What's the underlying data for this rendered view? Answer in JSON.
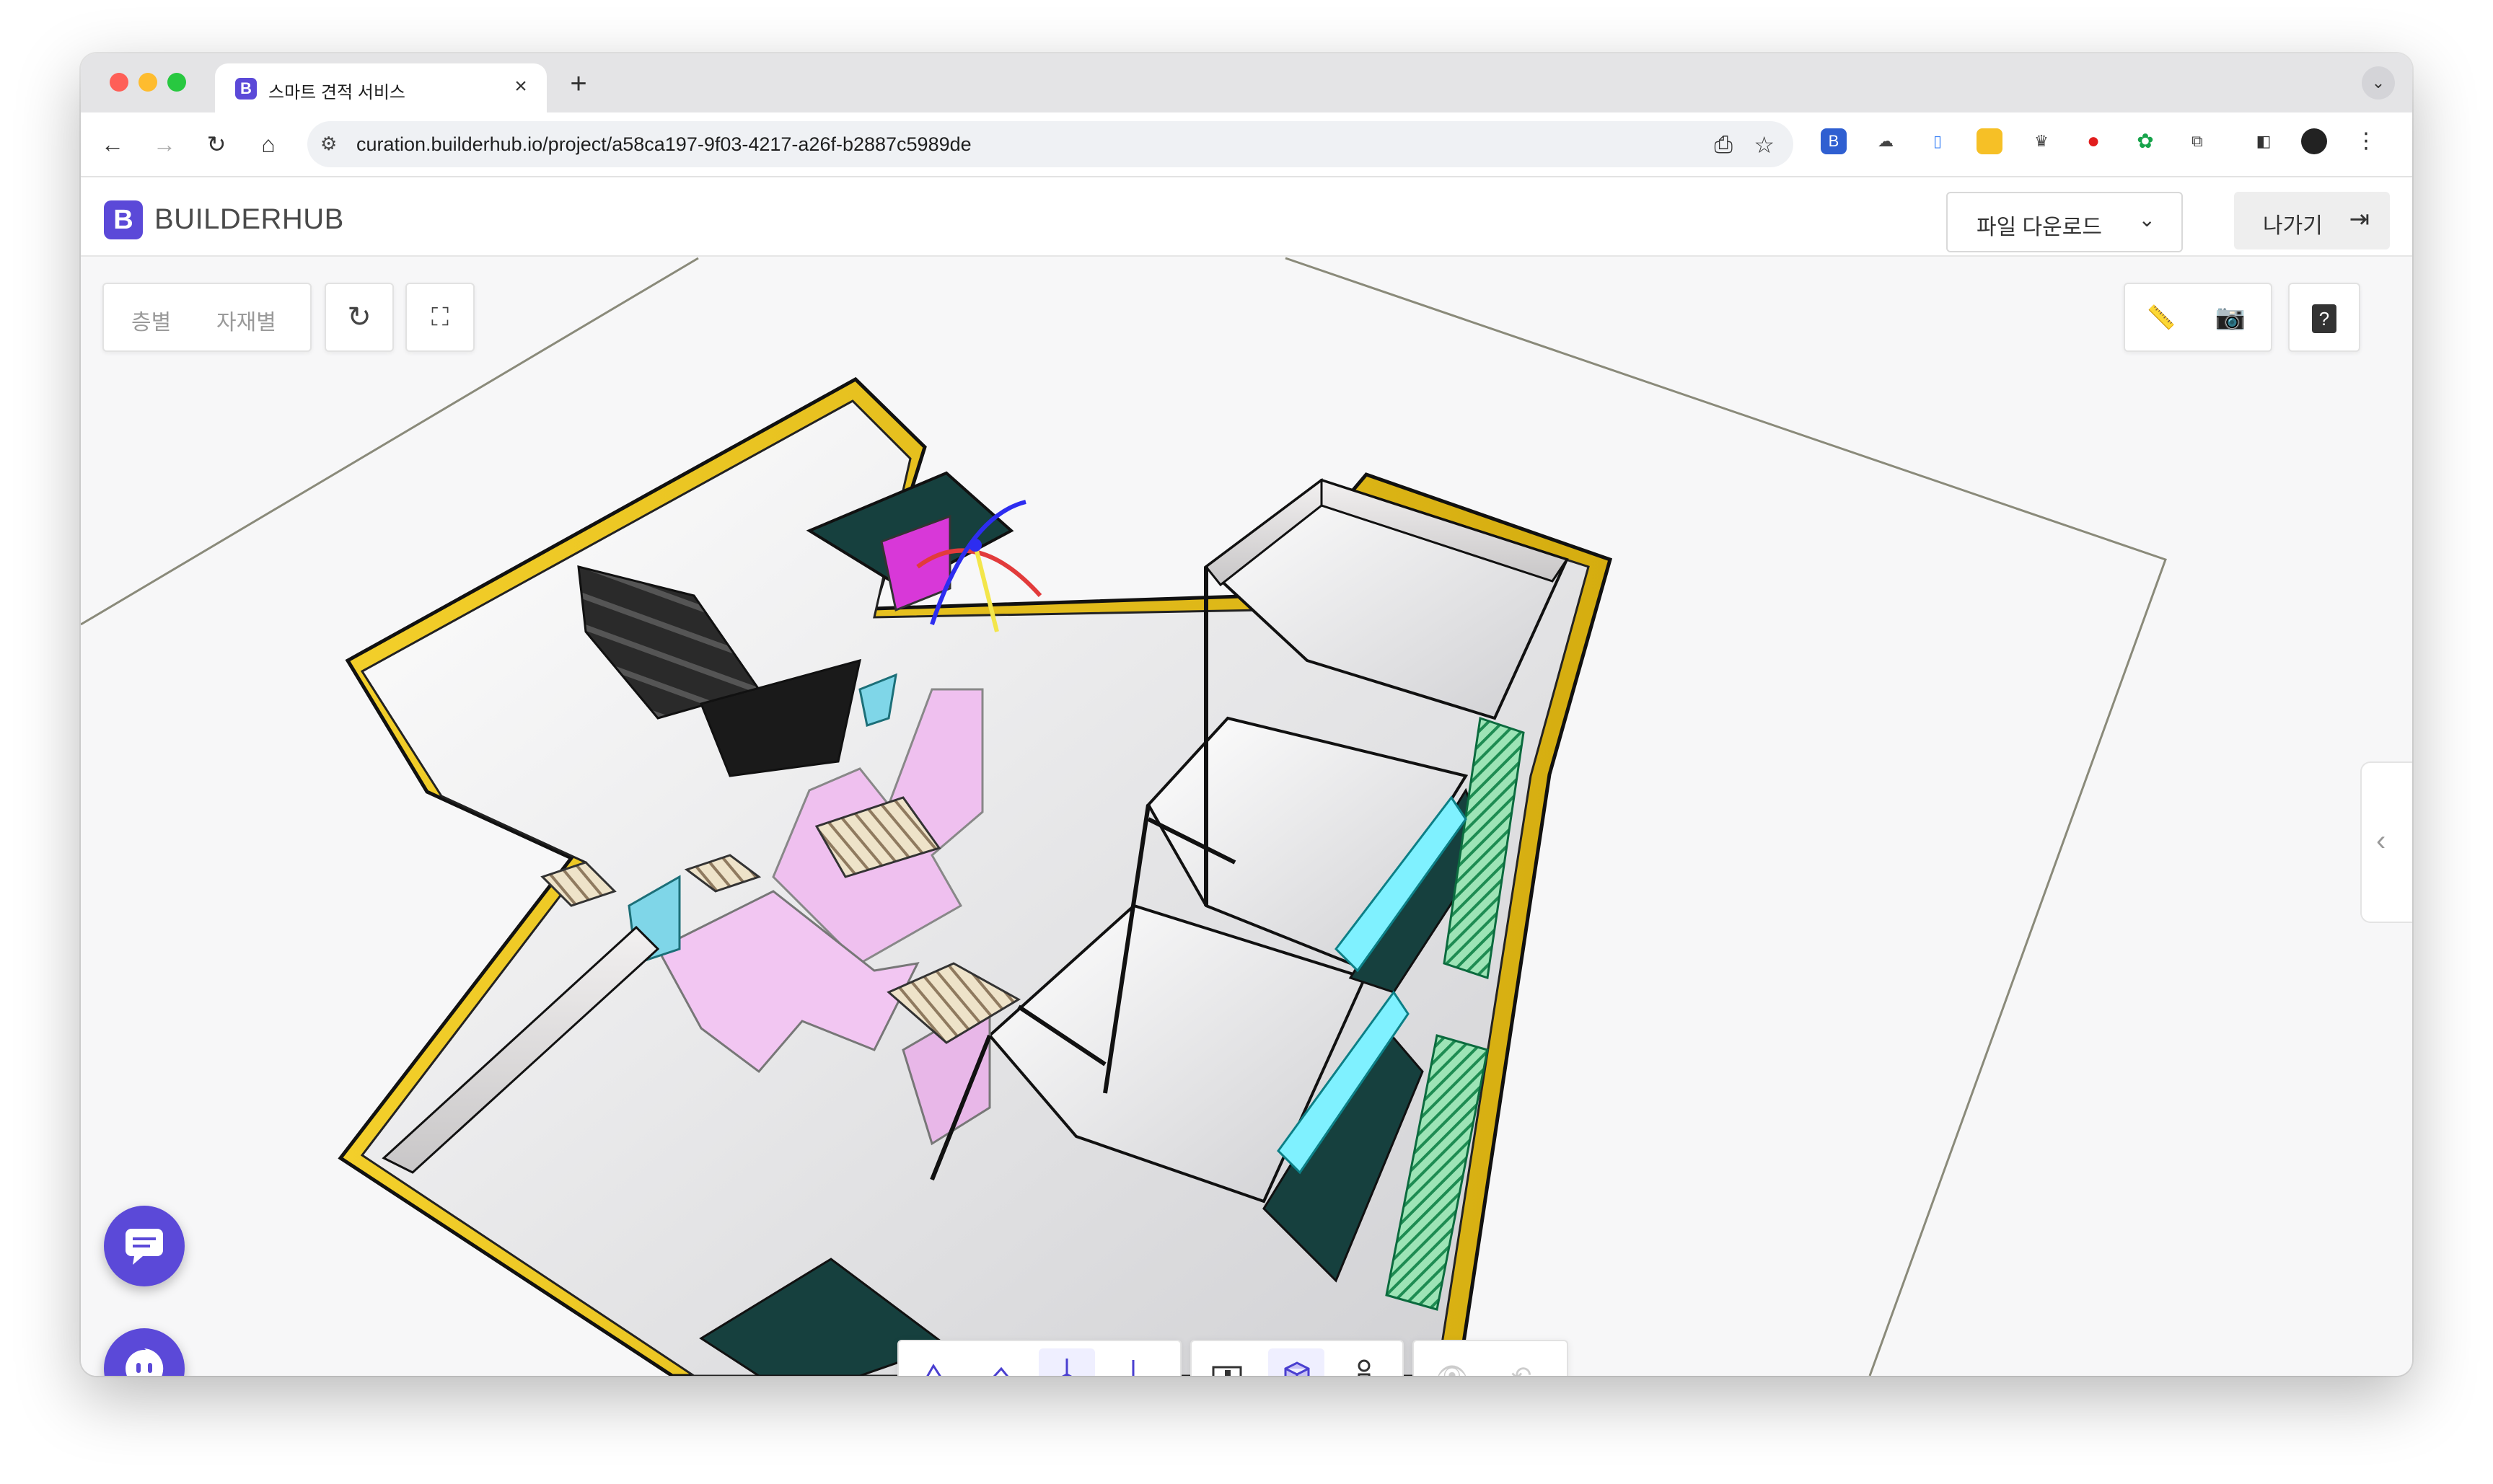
{
  "browser": {
    "tab_title": "스마트 견적 서비스",
    "tab_favicon": "B",
    "tab_close": "×",
    "new_tab": "+",
    "url": "curation.builderhub.io/project/a58ca197-9f03-4217-a26f-b2887c5989de",
    "nav_icons": [
      "back-icon",
      "forward-icon",
      "reload-icon",
      "home-icon"
    ],
    "extension_icons": [
      "builderhub-ext-icon",
      "cloud-ext-icon",
      "docs-ext-icon",
      "notes-ext-icon",
      "crown-ext-icon",
      "opera-ext-icon",
      "color-ext-icon",
      "puzzle-extensions-icon"
    ]
  },
  "app": {
    "logo_mark": "B",
    "logo_text": "BUILDERHUB",
    "download_label": "파일 다운로드",
    "exit_label": "나가기",
    "accent": "#5b49d8"
  },
  "viewer": {
    "filter_tabs": [
      "층별",
      "자재별"
    ],
    "reset_icon": "reload-icon",
    "fit_icon": "focus-icon",
    "ruler_icon": "ruler-icon",
    "camera_icon": "camera-icon",
    "help_icon": "help-book-icon",
    "side_toggle": "chevron-left-icon",
    "view_buttons": [
      "view-front-icon",
      "view-side-icon",
      "view-top-icon",
      "view-axis-icon"
    ],
    "mode_buttons": [
      "section-icon",
      "box-icon",
      "person-icon"
    ],
    "aux_buttons": [
      "eye-icon",
      "undo-icon"
    ],
    "active_view": "view-top-icon",
    "active_mode": "box-icon"
  },
  "fabs": [
    "chat-icon",
    "chatbot-icon"
  ]
}
